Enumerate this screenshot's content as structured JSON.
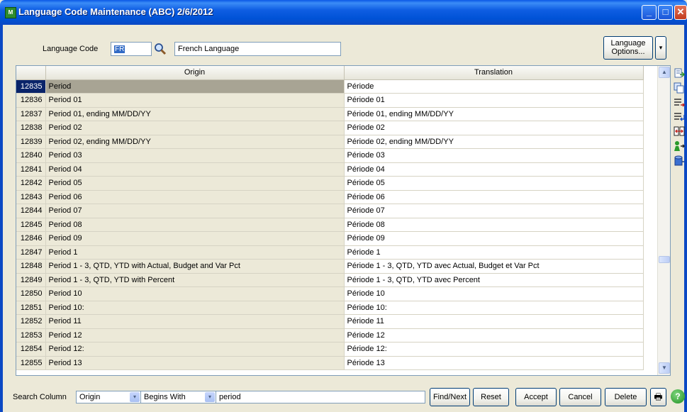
{
  "window": {
    "title": "Language Code Maintenance (ABC) 2/6/2012",
    "app_icon_text": "M",
    "minimize": "_",
    "maximize": "□",
    "close": "✕"
  },
  "header": {
    "language_code_label": "Language Code",
    "language_code_value": "FR",
    "language_name": "French Language",
    "language_options_label_1": "Language",
    "language_options_label_2": "Options...",
    "dropdown_arrow": "▾"
  },
  "grid": {
    "columns": [
      "",
      "Origin",
      "Translation"
    ],
    "selected_row": "12835",
    "rows": [
      {
        "id": "12835",
        "origin": "Period",
        "translation": "Période"
      },
      {
        "id": "12836",
        "origin": "Period 01",
        "translation": "Période 01"
      },
      {
        "id": "12837",
        "origin": "Period 01, ending MM/DD/YY",
        "translation": "Période 01, ending MM/DD/YY"
      },
      {
        "id": "12838",
        "origin": "Period 02",
        "translation": "Période 02"
      },
      {
        "id": "12839",
        "origin": "Period 02, ending MM/DD/YY",
        "translation": "Période 02, ending MM/DD/YY"
      },
      {
        "id": "12840",
        "origin": "Period 03",
        "translation": "Période 03"
      },
      {
        "id": "12841",
        "origin": "Period 04",
        "translation": "Période 04"
      },
      {
        "id": "12842",
        "origin": "Period 05",
        "translation": "Période 05"
      },
      {
        "id": "12843",
        "origin": "Period 06",
        "translation": "Période 06"
      },
      {
        "id": "12844",
        "origin": "Period 07",
        "translation": "Période 07"
      },
      {
        "id": "12845",
        "origin": "Period 08",
        "translation": "Période 08"
      },
      {
        "id": "12846",
        "origin": "Period 09",
        "translation": "Période 09"
      },
      {
        "id": "12847",
        "origin": "Period 1",
        "translation": "Période 1"
      },
      {
        "id": "12848",
        "origin": "Period 1 - 3, QTD, YTD with Actual, Budget and Var Pct",
        "translation": "Période 1 - 3, QTD, YTD avec Actual, Budget et Var Pct"
      },
      {
        "id": "12849",
        "origin": "Period 1 - 3, QTD, YTD with Percent",
        "translation": "Période 1 - 3, QTD, YTD avec Percent"
      },
      {
        "id": "12850",
        "origin": "Period 10",
        "translation": "Période 10"
      },
      {
        "id": "12851",
        "origin": "Period 10:",
        "translation": "Période 10:"
      },
      {
        "id": "12852",
        "origin": "Period 11",
        "translation": "Période 11"
      },
      {
        "id": "12853",
        "origin": "Period 12",
        "translation": "Période 12"
      },
      {
        "id": "12854",
        "origin": "Period 12:",
        "translation": "Période 12:"
      },
      {
        "id": "12855",
        "origin": "Period 13",
        "translation": "Période 13"
      }
    ],
    "scroll_up": "▲",
    "scroll_down": "▼"
  },
  "side_icons": [
    "export-icon",
    "copy-icon",
    "delete-lines-icon",
    "insert-lines-icon",
    "merge-icon",
    "user-transfer-icon",
    "database-icon"
  ],
  "footer": {
    "search_column_label": "Search Column",
    "search_column_value": "Origin",
    "search_mode_value": "Begins With",
    "search_text": "period",
    "find_next": "Find/Next",
    "reset": "Reset",
    "accept": "Accept",
    "cancel": "Cancel",
    "delete": "Delete",
    "print_icon": "🖶",
    "help_icon": "?",
    "combo_arrow": "▾"
  },
  "colors": {
    "title_bar": "#0b49c4",
    "selected_row_id": "#0a246a",
    "selected_row_origin": "#a8a494",
    "window_bg": "#ece9d8"
  }
}
